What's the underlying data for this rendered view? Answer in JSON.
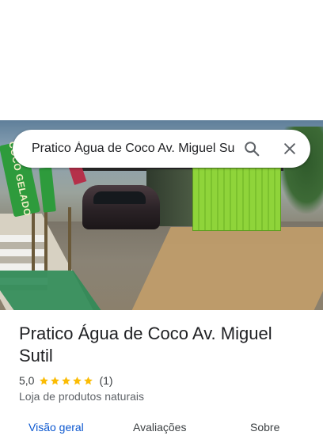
{
  "search": {
    "query": "Pratico Água de Coco Av. Miguel Sutil"
  },
  "photo": {
    "banner_text": "COCO GELADO"
  },
  "place": {
    "name": "Pratico Água de Coco Av. Miguel Sutil",
    "rating": "5,0",
    "review_count": "(1)",
    "stars": 5,
    "category": "Loja de produtos naturais"
  },
  "tabs": [
    {
      "label": "Visão geral",
      "active": true
    },
    {
      "label": "Avaliações",
      "active": false
    },
    {
      "label": "Sobre",
      "active": false
    }
  ],
  "icons": {
    "search": "search-icon",
    "close": "close-icon",
    "star": "star-icon"
  },
  "colors": {
    "accent": "#0b57d0",
    "star": "#fbbc04",
    "text": "#202124",
    "secondary_text": "#5f6368"
  }
}
